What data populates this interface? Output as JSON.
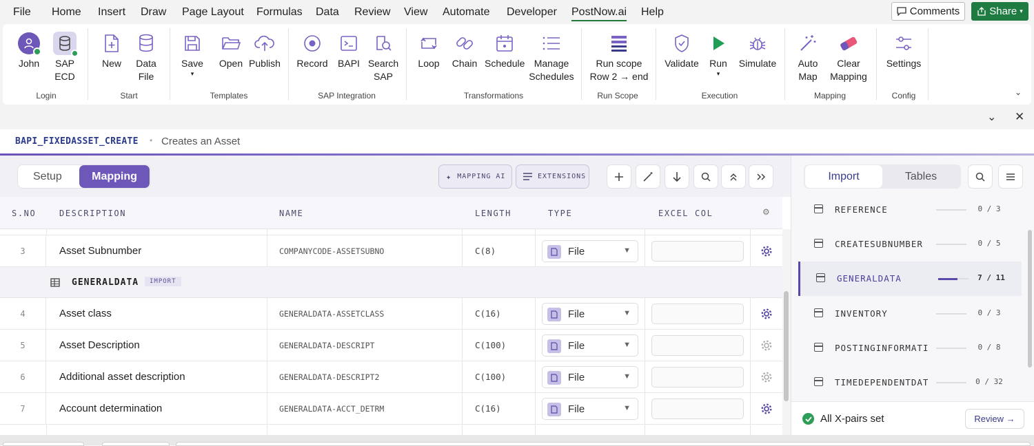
{
  "menubar": {
    "items": [
      "File",
      "Home",
      "Insert",
      "Draw",
      "Page Layout",
      "Formulas",
      "Data",
      "Review",
      "View",
      "Automate",
      "Developer",
      "PostNow.ai",
      "Help"
    ],
    "active": "PostNow.ai",
    "comments_label": "Comments",
    "share_label": "Share"
  },
  "ribbon": {
    "groups": {
      "login": "Login",
      "start": "Start",
      "templates": "Templates",
      "sap_integration": "SAP Integration",
      "transformations": "Transformations",
      "run_scope": "Run Scope",
      "execution": "Execution",
      "mapping": "Mapping",
      "config": "Config"
    },
    "buttons": {
      "john": "John",
      "sap_ecd_1": "SAP",
      "sap_ecd_2": "ECD",
      "new": "New",
      "data_file_1": "Data",
      "data_file_2": "File",
      "save": "Save",
      "open": "Open",
      "publish": "Publish",
      "record": "Record",
      "bapi": "BAPI",
      "search_sap_1": "Search",
      "search_sap_2": "SAP",
      "loop": "Loop",
      "chain": "Chain",
      "schedule": "Schedule",
      "manage_1": "Manage",
      "manage_2": "Schedules",
      "run_scope_1": "Run scope",
      "run_scope_2": "Row 2 → end",
      "validate": "Validate",
      "run": "Run",
      "simulate": "Simulate",
      "auto_map_1": "Auto",
      "auto_map_2": "Map",
      "clear_map_1": "Clear",
      "clear_map_2": "Mapping",
      "settings": "Settings"
    }
  },
  "header": {
    "rfc": "BAPI_FIXEDASSET_CREATE",
    "separator": "•",
    "description": "Creates an Asset"
  },
  "toolbar": {
    "setup": "Setup",
    "mapping": "Mapping",
    "mapping_ai": "MAPPING AI",
    "extensions": "EXTENSIONS"
  },
  "table": {
    "columns": [
      "S.NO",
      "DESCRIPTION",
      "NAME",
      "LENGTH",
      "TYPE",
      "EXCEL COL"
    ],
    "rows": [
      {
        "sno": "3",
        "desc": "Asset Subnumber",
        "name": "COMPANYCODE-ASSETSUBNO",
        "length": "C(8)",
        "type": "File"
      },
      {
        "sno": "4",
        "desc": "Asset class",
        "name": "GENERALDATA-ASSETCLASS",
        "length": "C(16)",
        "type": "File"
      },
      {
        "sno": "5",
        "desc": "Asset Description",
        "name": "GENERALDATA-DESCRIPT",
        "length": "C(100)",
        "type": "File"
      },
      {
        "sno": "6",
        "desc": "Additional asset description",
        "name": "GENERALDATA-DESCRIPT2",
        "length": "C(100)",
        "type": "File"
      },
      {
        "sno": "7",
        "desc": "Account determination",
        "name": "GENERALDATA-ACCT_DETRM",
        "length": "C(16)",
        "type": "File"
      }
    ],
    "group": {
      "name": "GENERALDATA",
      "badge": "IMPORT"
    }
  },
  "sidebar": {
    "tab_import": "Import",
    "tab_tables": "Tables",
    "items": [
      {
        "name": "REFERENCE",
        "count": "0 / 3",
        "progress": 0
      },
      {
        "name": "CREATESUBNUMBER",
        "count": "0 / 5",
        "progress": 0
      },
      {
        "name": "GENERALDATA",
        "count": "7 / 11",
        "progress": 0.64
      },
      {
        "name": "INVENTORY",
        "count": "0 / 3",
        "progress": 0
      },
      {
        "name": "POSTINGINFORMATI…",
        "count": "0 / 8",
        "progress": 0
      },
      {
        "name": "TIMEDEPENDENTDATA",
        "count": "0 / 32",
        "progress": 0
      }
    ],
    "footer_status": "All X-pairs set",
    "review_label": "Review →"
  },
  "colors": {
    "accent": "#6d57b8",
    "share_green": "#1e7b41",
    "ok_green": "#2e9d57"
  }
}
